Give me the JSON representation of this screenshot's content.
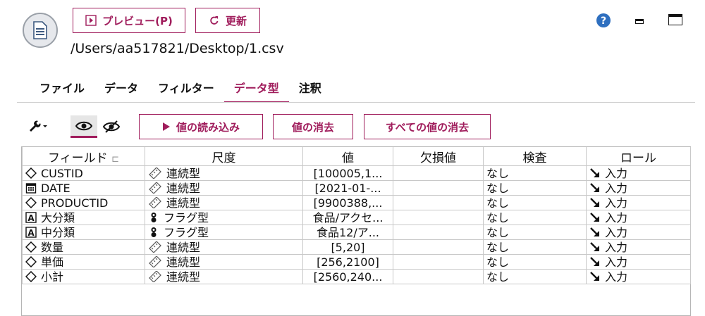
{
  "toolbar": {
    "preview_label": "プレビュー(P)",
    "refresh_label": "更新",
    "file_path": "/Users/aa517821/Desktop/1.csv"
  },
  "tabs": [
    "ファイル",
    "データ",
    "フィルター",
    "データ型",
    "注釈"
  ],
  "active_tab": "データ型",
  "actions": {
    "read_values": "値の読み込み",
    "clear_values": "値の消去",
    "clear_all_values": "すべての値の消去"
  },
  "columns": [
    "フィールド",
    "尺度",
    "値",
    "欠損値",
    "検査",
    "ロール"
  ],
  "rows": [
    {
      "icon": "diamond-icon",
      "field": "CUSTID",
      "measure_icon": "ruler-icon",
      "measure": "連続型",
      "values": "[100005,1...",
      "missing": "",
      "check": "なし",
      "role": "入力"
    },
    {
      "icon": "calendar-icon",
      "field": "DATE",
      "measure_icon": "ruler-icon",
      "measure": "連続型",
      "values": "[2021-01-...",
      "missing": "",
      "check": "なし",
      "role": "入力"
    },
    {
      "icon": "diamond-icon",
      "field": "PRODUCTID",
      "measure_icon": "ruler-icon",
      "measure": "連続型",
      "values": "[9900388,...",
      "missing": "",
      "check": "なし",
      "role": "入力"
    },
    {
      "icon": "string-icon",
      "field": "大分類",
      "measure_icon": "flag-icon",
      "measure": "フラグ型",
      "values": "食品/アクセ...",
      "missing": "",
      "check": "なし",
      "role": "入力"
    },
    {
      "icon": "string-icon",
      "field": "中分類",
      "measure_icon": "flag-icon",
      "measure": "フラグ型",
      "values": "食品12/ア...",
      "missing": "",
      "check": "なし",
      "role": "入力"
    },
    {
      "icon": "diamond-icon",
      "field": "数量",
      "measure_icon": "ruler-icon",
      "measure": "連続型",
      "values": "[5,20]",
      "missing": "",
      "check": "なし",
      "role": "入力"
    },
    {
      "icon": "diamond-icon",
      "field": "単価",
      "measure_icon": "ruler-icon",
      "measure": "連続型",
      "values": "[256,2100]",
      "missing": "",
      "check": "なし",
      "role": "入力"
    },
    {
      "icon": "diamond-icon",
      "field": "小計",
      "measure_icon": "ruler-icon",
      "measure": "連続型",
      "values": "[2560,240...",
      "missing": "",
      "check": "なし",
      "role": "入力"
    }
  ],
  "colors": {
    "accent": "#a01d5c",
    "help": "#2e6fbf"
  }
}
